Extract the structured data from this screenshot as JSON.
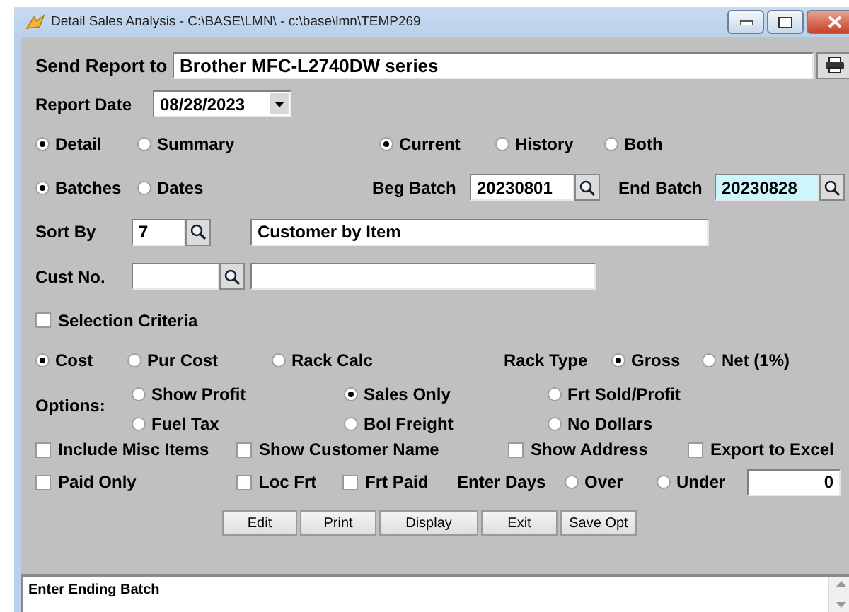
{
  "window": {
    "title": "Detail Sales Analysis - C:\\BASE\\LMN\\ - c:\\base\\lmn\\TEMP269"
  },
  "send_report_to": {
    "label": "Send Report to",
    "value": "Brother MFC-L2740DW series"
  },
  "report_date": {
    "label": "Report Date",
    "value": "08/28/2023"
  },
  "report_type": [
    {
      "label": "Detail",
      "selected": true
    },
    {
      "label": "Summary",
      "selected": false
    }
  ],
  "source": [
    {
      "label": "Current",
      "selected": true
    },
    {
      "label": "History",
      "selected": false
    },
    {
      "label": "Both",
      "selected": false
    }
  ],
  "range": [
    {
      "label": "Batches",
      "selected": true
    },
    {
      "label": "Dates",
      "selected": false
    }
  ],
  "beg_batch": {
    "label": "Beg Batch",
    "value": "20230801",
    "focused": false
  },
  "end_batch": {
    "label": "End Batch",
    "value": "20230828",
    "focused": true
  },
  "sort_by": {
    "label": "Sort By",
    "value": "7",
    "description": "Customer by Item"
  },
  "cust_no": {
    "label": "Cust No."
  },
  "selection_criteria": {
    "label": "Selection Criteria",
    "checked": false
  },
  "cost": [
    {
      "label": "Cost",
      "selected": true
    },
    {
      "label": "Pur Cost",
      "selected": false
    },
    {
      "label": "Rack Calc",
      "selected": false
    }
  ],
  "rack_type": {
    "label": "Rack Type",
    "options": [
      {
        "label": "Gross",
        "selected": true
      },
      {
        "label": "Net (1%)",
        "selected": false
      }
    ]
  },
  "options": {
    "label": "Options:",
    "items": [
      {
        "label": "Show Profit",
        "selected": false
      },
      {
        "label": "Sales Only",
        "selected": true
      },
      {
        "label": "Frt Sold/Profit",
        "selected": false
      },
      {
        "label": "Fuel Tax",
        "selected": false
      },
      {
        "label": "Bol Freight",
        "selected": false
      },
      {
        "label": "No Dollars",
        "selected": false
      }
    ]
  },
  "checks_row_1": [
    {
      "label": "Include Misc Items",
      "checked": false
    },
    {
      "label": "Show Customer Name",
      "checked": false
    },
    {
      "label": "Show Address",
      "checked": false
    },
    {
      "label": "Export to Excel",
      "checked": false
    }
  ],
  "checks_row_2": [
    {
      "label": "Paid Only",
      "checked": false
    },
    {
      "label": "Loc Frt",
      "checked": false
    },
    {
      "label": "Frt Paid",
      "checked": false
    }
  ],
  "enter_days": {
    "label": "Enter Days",
    "options": [
      {
        "label": "Over",
        "selected": false
      },
      {
        "label": "Under",
        "selected": false
      }
    ],
    "value": "0"
  },
  "buttons": [
    "Edit",
    "Print",
    "Display",
    "Exit",
    "Save Opt"
  ],
  "status": "Enter Ending Batch"
}
